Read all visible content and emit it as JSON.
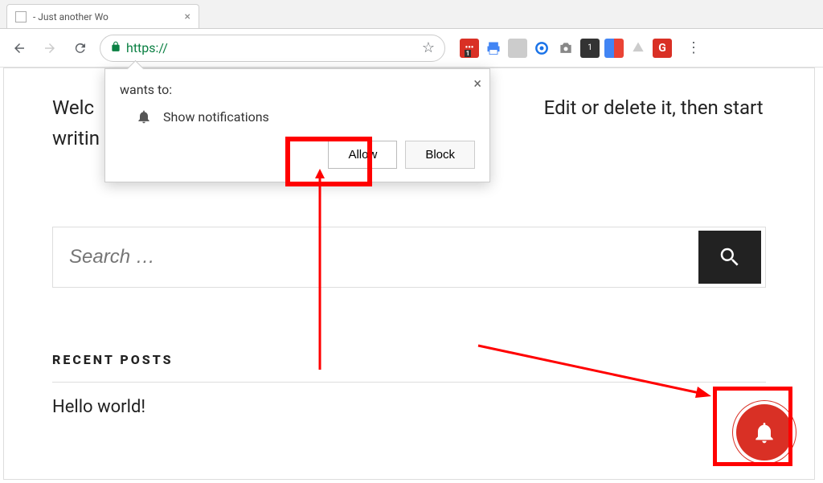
{
  "browser": {
    "tab_title": " - Just another Wo",
    "url": "https://",
    "nav": {
      "back_enabled": true,
      "forward_enabled": false
    }
  },
  "permission_popup": {
    "site": "",
    "wants_to": " wants to:",
    "permission_label": "Show notifications",
    "allow_label": "Allow",
    "block_label": "Block"
  },
  "page": {
    "welcome_line1_prefix": "Welc",
    "welcome_line1_suffix": "Edit or delete it, then start",
    "welcome_line2": "writin",
    "search_placeholder": "Search …",
    "recent_posts_heading": "RECENT POSTS",
    "posts": [
      {
        "title": "Hello world!"
      }
    ]
  }
}
